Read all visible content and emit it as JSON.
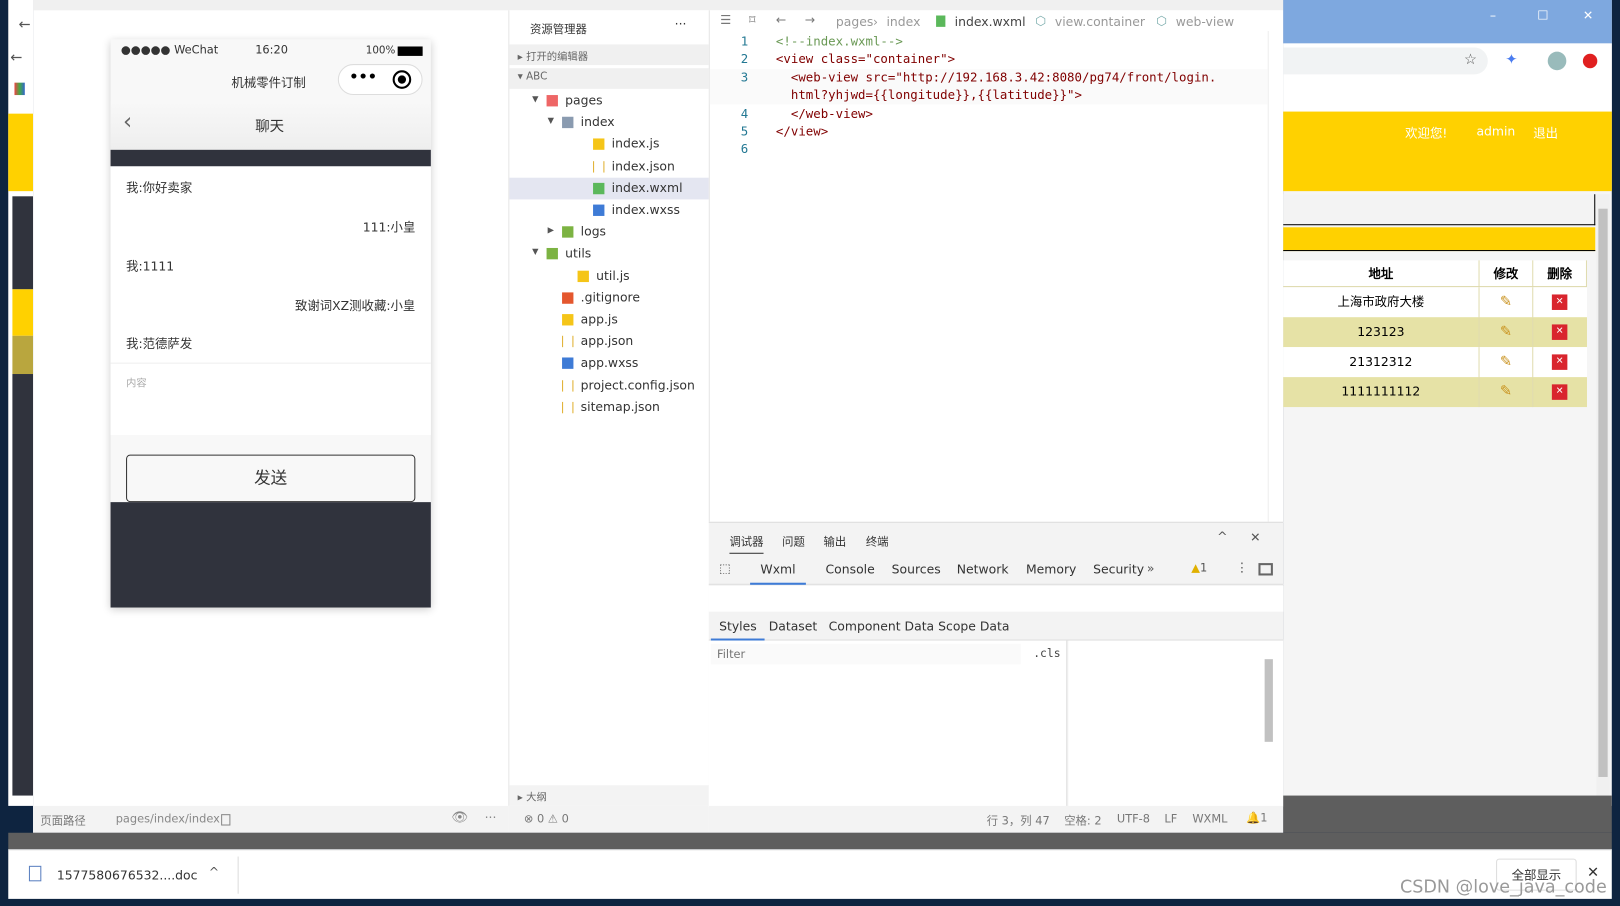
{
  "simulator": {
    "status_bar": {
      "carrier": "●●●●● WeChat",
      "time": "16:20",
      "battery": "100%"
    },
    "app_title": "机械零件订制",
    "nav_title": "聊天",
    "messages": [
      {
        "side": "left",
        "text": "我:你好卖家"
      },
      {
        "side": "right",
        "text": "111:小皇"
      },
      {
        "side": "left",
        "text": "我:1111"
      },
      {
        "side": "right",
        "text": "致谢词XZ测收藏:小皇"
      },
      {
        "side": "left",
        "text": "我:范德萨发"
      }
    ],
    "input_placeholder": "内容",
    "send_button": "发送",
    "footer": {
      "path_label": "页面路径",
      "path": "pages/index/index"
    }
  },
  "explorer": {
    "title": "资源管理器",
    "more": "···",
    "open_editors": "打开的编辑器",
    "project": "ABC",
    "tree": [
      {
        "name": "pages",
        "depth": 0,
        "type": "folder-red",
        "open": true
      },
      {
        "name": "index",
        "depth": 1,
        "type": "folder",
        "open": true
      },
      {
        "name": "index.js",
        "depth": 2,
        "type": "js"
      },
      {
        "name": "index.json",
        "depth": 2,
        "type": "json"
      },
      {
        "name": "index.wxml",
        "depth": 2,
        "type": "wxml",
        "selected": true
      },
      {
        "name": "index.wxss",
        "depth": 2,
        "type": "wxss"
      },
      {
        "name": "logs",
        "depth": 1,
        "type": "folder-green",
        "open": false
      },
      {
        "name": "utils",
        "depth": 0,
        "type": "folder-green",
        "open": true
      },
      {
        "name": "util.js",
        "depth": 1,
        "type": "js"
      },
      {
        "name": ".gitignore",
        "depth": 0,
        "type": "git"
      },
      {
        "name": "app.js",
        "depth": 0,
        "type": "js"
      },
      {
        "name": "app.json",
        "depth": 0,
        "type": "json"
      },
      {
        "name": "app.wxss",
        "depth": 0,
        "type": "wxss"
      },
      {
        "name": "project.config.json",
        "depth": 0,
        "type": "json"
      },
      {
        "name": "sitemap.json",
        "depth": 0,
        "type": "json"
      }
    ],
    "outline": "大纲",
    "problems": "⊗ 0 ⚠ 0"
  },
  "editor": {
    "breadcrumb": [
      "pages",
      "index",
      "index.wxml",
      "view.container",
      "web-view"
    ],
    "lines": [
      {
        "n": "1",
        "code": "<!--index.wxml-->"
      },
      {
        "n": "2",
        "code": "<view class=\"container\">"
      },
      {
        "n": "3",
        "code": "  <web-view src=\"http://192.168.3.42:8080/pg74/front/login."
      },
      {
        "n": "",
        "code": "  html?yhjwd={{longitude}},{{latitude}}\">"
      },
      {
        "n": "4",
        "code": "  </web-view>"
      },
      {
        "n": "5",
        "code": "</view>"
      },
      {
        "n": "6",
        "code": ""
      }
    ]
  },
  "debugger": {
    "tabs": [
      "调试器",
      "问题",
      "输出",
      "终端"
    ],
    "devtools_tabs": [
      "Wxml",
      "Console",
      "Sources",
      "Network",
      "Memory",
      "Security"
    ],
    "more": "»",
    "warnings": "1",
    "sub_tabs": [
      "Styles",
      "Dataset",
      "Component Data",
      "Scope Data"
    ],
    "filter_placeholder": "Filter",
    "cls": ".cls"
  },
  "status": {
    "position": "行 3，列 47",
    "spaces": "空格: 2",
    "encoding": "UTF-8",
    "eol": "LF",
    "lang": "WXML",
    "bell": "1"
  },
  "browser": {
    "welcome": "欢迎您!",
    "user": "admin",
    "logout": "退出",
    "table": {
      "headers": [
        "地址",
        "修改",
        "删除"
      ],
      "rows": [
        "上海市政府大楼",
        "123123",
        "21312312",
        "1111111112"
      ]
    }
  },
  "downloads": {
    "file": "1577580676532....doc",
    "show_all": "全部显示"
  },
  "watermark": "CSDN @love_java_code",
  "colors": {
    "accent_yellow": "#ffd100",
    "devtools_blue": "#3e7bd6",
    "row_alt": "#e6e2a6"
  }
}
